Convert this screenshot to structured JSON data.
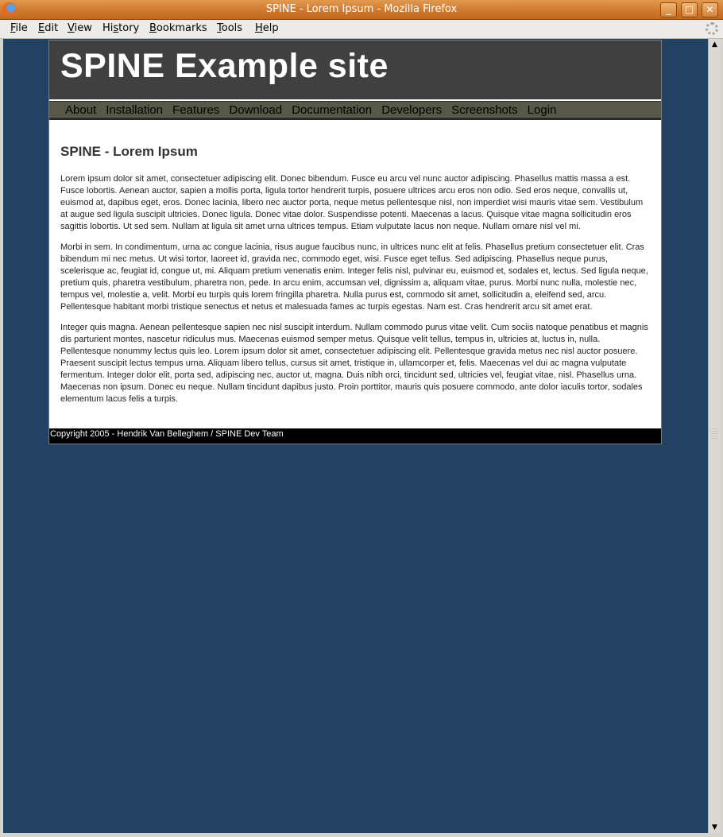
{
  "window": {
    "title": "SPINE - Lorem Ipsum - Mozilla Firefox",
    "buttons": {
      "minimize": "_",
      "maximize": "□",
      "close": "✕"
    }
  },
  "menu": {
    "items": [
      {
        "accel": "F",
        "rest": "ile"
      },
      {
        "accel": "E",
        "rest": "dit"
      },
      {
        "accel": "V",
        "rest": "iew"
      },
      {
        "pre": "Hi",
        "accel": "s",
        "rest": "tory"
      },
      {
        "accel": "B",
        "rest": "ookmarks"
      },
      {
        "accel": "T",
        "rest": "ools"
      },
      {
        "accel": "H",
        "rest": "elp"
      }
    ]
  },
  "site": {
    "title": "SPINE Example site",
    "nav": [
      "About",
      "Installation",
      "Features",
      "Download",
      "Documentation",
      "Developers",
      "Screenshots",
      "Login"
    ],
    "heading": "SPINE - Lorem Ipsum",
    "paragraphs": [
      "Lorem ipsum dolor sit amet, consectetuer adipiscing elit. Donec bibendum. Fusce eu arcu vel nunc auctor adipiscing. Phasellus mattis massa a est. Fusce lobortis. Aenean auctor, sapien a mollis porta, ligula tortor hendrerit turpis, posuere ultrices arcu eros non odio. Sed eros neque, convallis ut, euismod at, dapibus eget, eros. Donec lacinia, libero nec auctor porta, neque metus pellentesque nisl, non imperdiet wisi mauris vitae sem. Vestibulum at augue sed ligula suscipit ultricies. Donec ligula. Donec vitae dolor. Suspendisse potenti. Maecenas a lacus. Quisque vitae magna sollicitudin eros sagittis lobortis. Ut sed sem. Nullam at ligula sit amet urna ultrices tempus. Etiam vulputate lacus non neque. Nullam ornare nisl vel mi.",
      "Morbi in sem. In condimentum, urna ac congue lacinia, risus augue faucibus nunc, in ultrices nunc elit at felis. Phasellus pretium consectetuer elit. Cras bibendum mi nec metus. Ut wisi tortor, laoreet id, gravida nec, commodo eget, wisi. Fusce eget tellus. Sed adipiscing. Phasellus neque purus, scelerisque ac, feugiat id, congue ut, mi. Aliquam pretium venenatis enim. Integer felis nisl, pulvinar eu, euismod et, sodales et, lectus. Sed ligula neque, pretium quis, pharetra vestibulum, pharetra non, pede. In arcu enim, accumsan vel, dignissim a, aliquam vitae, purus. Morbi nunc nulla, molestie nec, tempus vel, molestie a, velit. Morbi eu turpis quis lorem fringilla pharetra. Nulla purus est, commodo sit amet, sollicitudin a, eleifend sed, arcu. Pellentesque habitant morbi tristique senectus et netus et malesuada fames ac turpis egestas. Nam est. Cras hendrerit arcu sit amet erat.",
      "Integer quis magna. Aenean pellentesque sapien nec nisl suscipit interdum. Nullam commodo purus vitae velit. Cum sociis natoque penatibus et magnis dis parturient montes, nascetur ridiculus mus. Maecenas euismod semper metus. Quisque velit tellus, tempus in, ultricies at, luctus in, nulla. Pellentesque nonummy lectus quis leo. Lorem ipsum dolor sit amet, consectetuer adipiscing elit. Pellentesque gravida metus nec nisl auctor posuere. Praesent suscipit lectus tempus urna. Aliquam libero tellus, cursus sit amet, tristique in, ullamcorper et, felis. Maecenas vel dui ac magna vulputate fermentum. Integer dolor elit, porta sed, adipiscing nec, auctor ut, magna. Duis nibh orci, tincidunt sed, ultricies vel, feugiat vitae, nisl. Phasellus urna. Maecenas non ipsum. Donec eu neque. Nullam tincidunt dapibus justo. Proin porttitor, mauris quis posuere commodo, ante dolor iaculis tortor, sodales elementum lacus felis a turpis."
    ],
    "footer": "Copyright 2005 - Hendrik Van Belleghem / SPINE Dev Team"
  },
  "colors": {
    "page_background": "#234263",
    "header_background": "#404040",
    "nav_background": "#575847",
    "footer_background": "#000000",
    "titlebar": "#cf7a2e"
  },
  "icons": {
    "app": "firefox-icon",
    "throbber": "throbber-icon",
    "scroll_up": "scroll-up-arrow-icon",
    "scroll_down": "scroll-down-arrow-icon"
  }
}
